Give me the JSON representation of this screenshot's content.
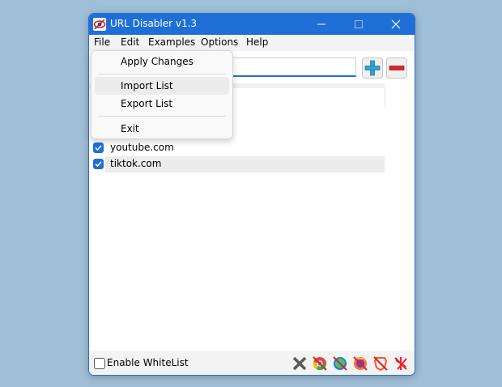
{
  "window": {
    "title": "URL Disabler v1.3"
  },
  "menu": {
    "items": [
      "File",
      "Edit",
      "Examples",
      "Options",
      "Help"
    ],
    "file_dropdown": {
      "apply": "Apply Changes",
      "import": "Import List",
      "export": "Export List",
      "exit": "Exit"
    }
  },
  "url_list": {
    "items": [
      {
        "label": "youtube.com",
        "checked": true
      },
      {
        "label": "tiktok.com",
        "checked": true
      }
    ]
  },
  "bottom": {
    "whitelist_label": "Enable WhiteList",
    "whitelist_checked": false,
    "browser_icons": [
      "close-x-icon",
      "chrome-disabled-icon",
      "edge-disabled-icon",
      "firefox-disabled-icon",
      "brave-disabled-icon",
      "opera-disabled-icon"
    ]
  },
  "colors": {
    "accent": "#1e6fd6",
    "add_green_blue": "#2aa5d6",
    "remove_red": "#d9252a"
  }
}
